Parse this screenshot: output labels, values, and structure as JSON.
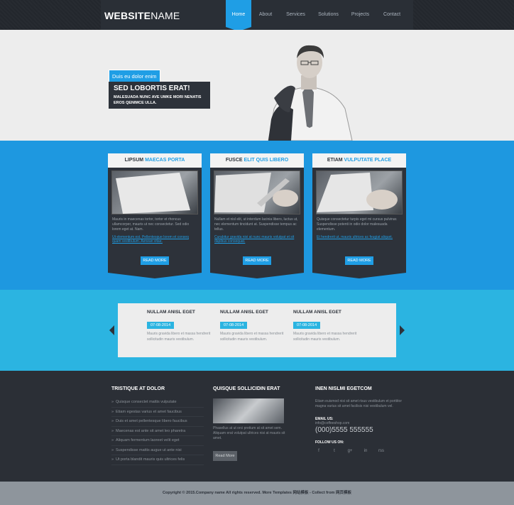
{
  "header": {
    "logo_bold": "WEBSITE",
    "logo_light": "NAME",
    "nav": [
      {
        "label": "Home",
        "active": true
      },
      {
        "label": "About",
        "active": false
      },
      {
        "label": "Services",
        "active": false
      },
      {
        "label": "Solutions",
        "active": false
      },
      {
        "label": "Projects",
        "active": false
      },
      {
        "label": "Contact",
        "active": false
      }
    ]
  },
  "hero": {
    "tag": "Duis eu dolor enim",
    "title": "SED LOBORTIS ERAT!",
    "text": "MALESUADA NUNC AVE UMKE MORI NENATIS EROS QENIMCE ULLA."
  },
  "features": [
    {
      "title_a": "LIPSUM",
      "title_b": "MAECAS PORTA",
      "text": "Mauris in maecenas tortor, tortor et rhoncus ullamcorper, mauris ut nec consectetur. Sed odio lorem eget at. Nam.",
      "link": "Ut elementum est. Pellentesque lorem et conseq quam vestibulum. Aenean vitae.",
      "button": "READ MORE"
    },
    {
      "title_a": "FUSCE",
      "title_b": "ELIT QUIS LIBERO",
      "text": "Nullam et nisl elit, ut interdum lacinia libero, luctus ut, nec elementum tincidunt at. Suspendisse tempus ac tellus.",
      "link": "Curabitur gravida nisi at nunc mauris volutpat et sit dapibus consequat.",
      "button": "READ MORE"
    },
    {
      "title_a": "ETIAM",
      "title_b": "VULPUTATE PLACE",
      "text": "Quisque consectetur turpis eget mi cursus pulvinar. Suspendisse potenti in odio dolor malesuada elementum.",
      "link": "Et hendrerit ut, mauris ultrices ac feugiat aliquet.",
      "button": "READ MORE"
    }
  ],
  "news": [
    {
      "title": "NULLAM ANISL EGET",
      "date": "07-08-2014",
      "text": "Mauris gravida libero et massa hendrerit sollicitudin mauris vestibulum."
    },
    {
      "title": "NULLAM ANISL EGET",
      "date": "07-08-2014",
      "text": "Mauris gravida libero et massa hendrerit sollicitudin mauris vestibulum."
    },
    {
      "title": "NULLAM ANISL EGET",
      "date": "07-08-2014",
      "text": "Mauris gravida libero et massa hendrerit sollicitudin mauris vestibulum."
    }
  ],
  "footer": {
    "col1_title": "TRISTIQUE AT DOLOR",
    "col1_items": [
      "Quisque consectet mattis vulputate",
      "Etiam egestas varius et amet faucibus",
      "Duis et amet pellentesque libero faucibus",
      "Maecenas est ante sit amet leo pharetra",
      "Aliquam fermentum laoreet velit eget",
      "Suspendisse mattis augue ut ante nisi",
      "Ut porta blandit mauris quis ultrices felis"
    ],
    "col2_title": "QUISQUE SOLLICIDIN ERAT",
    "col2_text": "Phasellus at ut orci pretium at sit amet sem. Aliquam erat volutpat ultrices nisi at mauris sit amet.",
    "col2_button": "Read More",
    "col3_title": "INEN NISLMI EGETCOM",
    "col3_text": "Etiam euismod nisi sit amet risus vestibulum et porttitor magna varius sit amet facilisis nisi vestibulum vel.",
    "email_label": "EMAIL US:",
    "email": "info@coffeeshop.com",
    "phone": "(000)5555 555555",
    "follow_label": "FOLLOW US ON:",
    "social": [
      "f",
      "t",
      "g+",
      "in",
      "rss"
    ]
  },
  "copyright": "Copyright © 2015.Company name All rights reserved. More Templates 网站模板 - Collect from 网页模板"
}
